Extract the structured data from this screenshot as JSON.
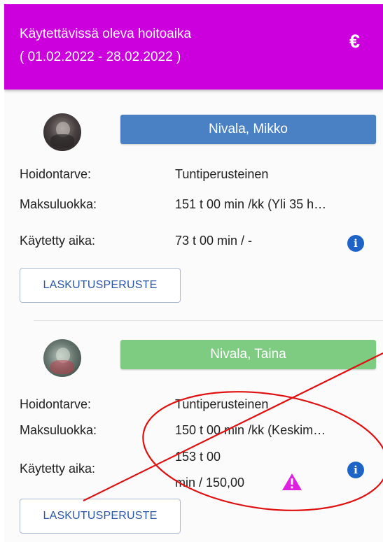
{
  "header": {
    "title": "Käytettävissä oleva hoitoaika",
    "date_range": "( 01.02.2022 - 28.02.2022 )",
    "currency_symbol": "€"
  },
  "children": [
    {
      "name": "Nivala, Mikko",
      "button_color": "#4a80c4",
      "labels": {
        "care_need": "Hoidontarve:",
        "fee_class": "Maksuluokka:",
        "used_time": "Käytetty aika:"
      },
      "care_need": "Tuntiperusteinen",
      "fee_class": "151 t 00 min /kk (Yli 35 h…",
      "used_time": "73 t 00 min / -",
      "billing_button": "LASKUTUSPERUSTE"
    },
    {
      "name": "Nivala, Taina",
      "button_color": "#7ecb82",
      "labels": {
        "care_need": "Hoidontarve:",
        "fee_class": "Maksuluokka:",
        "used_time": "Käytetty aika:"
      },
      "care_need": "Tuntiperusteinen",
      "fee_class": "150 t 00 min /kk (Keskim…",
      "used_time_line1": "153 t 00",
      "used_time_line2": "min / 150,00",
      "billing_button": "LASKUTUSPERUSTE"
    }
  ],
  "icons": {
    "info": "info-icon",
    "warning": "warning-icon",
    "euro": "euro-icon"
  },
  "colors": {
    "header": "#cc00dd",
    "annotation": "#e01010",
    "warning": "#e020e0",
    "info": "#1e64c8"
  }
}
